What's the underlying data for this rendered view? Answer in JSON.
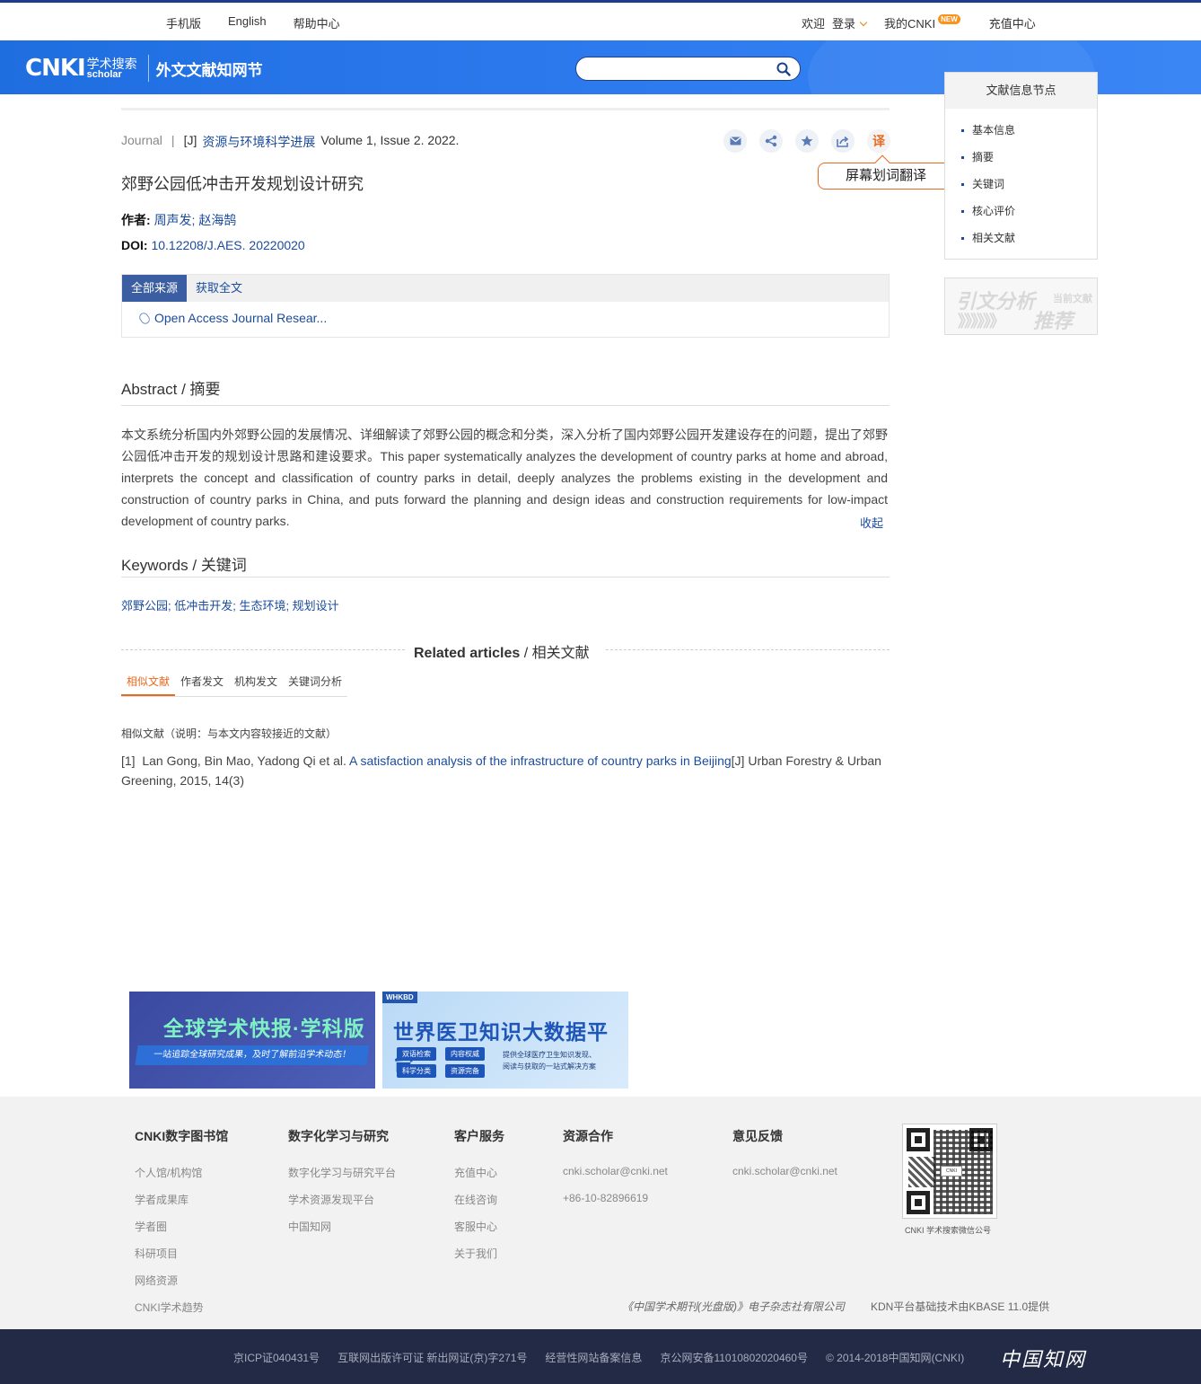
{
  "topbar": {
    "left_links": [
      "手机版",
      "English",
      "帮助中心"
    ],
    "welcome": "欢迎",
    "login": "登录",
    "my_cnki": "我的CNKI",
    "new_badge": "NEW",
    "recharge": "充值中心"
  },
  "header": {
    "logo_main": "CNKI",
    "logo_cn": "学术搜索",
    "logo_en": "scholar",
    "site_title": "外文文献知网节",
    "search_value": ""
  },
  "article": {
    "type": "Journal",
    "journal_code": "[J]",
    "journal": "资源与环境科学进展",
    "volume": "Volume 1, Issue 2. 2022.",
    "title": "郊野公园低冲击开发规划设计研究",
    "authors_label": "作者:",
    "authors": "周声发; 赵海鹄",
    "doi_label": "DOI:",
    "doi": "10.12208/J.AES. 20220020"
  },
  "tools": {
    "translate_glyph": "译",
    "tooltip": "屏幕划词翻译"
  },
  "source": {
    "tabs": [
      "全部来源",
      "获取全文"
    ],
    "link": "Open Access Journal Resear..."
  },
  "abstract": {
    "heading_en": "Abstract",
    "heading_cn": "摘要",
    "text": "本文系统分析国内外郊野公园的发展情况、详细解读了郊野公园的概念和分类，深入分析了国内郊野公园开发建设存在的问题，提出了郊野公园低冲击开发的规划设计思路和建设要求。This paper systematically analyzes the development of country parks at home and abroad, interprets the concept and classification of country parks in detail, deeply analyzes the problems existing in the development and construction of country parks in China, and puts forward the planning and design ideas and construction requirements for low-impact development of country parks.",
    "collapse": "收起"
  },
  "keywords": {
    "heading_en": "Keywords",
    "heading_cn": "关键词",
    "text": "郊野公园; 低冲击开发; 生态环境; 规划设计"
  },
  "related": {
    "heading_en": "Related articles",
    "heading_cn": "相关文献",
    "tabs": [
      "相似文献",
      "作者发文",
      "机构发文",
      "关键词分析"
    ],
    "note": "相似文献（说明：与本文内容较接近的文献）",
    "ref_index": "[1]",
    "ref_authors": "Lan Gong, Bin Mao, Yadong Qi et al.",
    "ref_title": "A satisfaction analysis of the infrastructure of country parks in Beijing",
    "ref_tail": "[J]  Urban Forestry & Urban Greening, 2015, 14(3)"
  },
  "sidebar": {
    "heading": "文献信息节点",
    "items": [
      "基本信息",
      "摘要",
      "关键词",
      "核心评价",
      "相关文献"
    ],
    "cite_a": "引文分析",
    "cite_b": "》》》》》》",
    "cite_c": "推荐",
    "cite_d": "当前文献"
  },
  "banners": {
    "b1_title": "全球学术快报·学科版",
    "b1_sub": "一站追踪全球研究成果，及时了解前沿学术动态！",
    "b2_tag": "WHKBD",
    "b2_title": "世界医卫知识大数据平台",
    "b2_pills": [
      "双语检索",
      "内容权威",
      "科学分类",
      "资源完备"
    ],
    "b2_desc1": "提供全球医疗卫生知识发现、",
    "b2_desc2": "阅读与获取的一站式解决方案"
  },
  "footer": {
    "cols": [
      {
        "title": "CNKI数字图书馆",
        "items": [
          "个人馆/机构馆",
          "学者成果库",
          "学者圈",
          "科研项目",
          "网络资源",
          "CNKI学术趋势"
        ]
      },
      {
        "title": "数字化学习与研究",
        "items": [
          "数字化学习与研究平台",
          "学术资源发现平台",
          "中国知网"
        ]
      },
      {
        "title": "客户服务",
        "items": [
          "充值中心",
          "在线咨询",
          "客服中心",
          "关于我们"
        ]
      },
      {
        "title": "资源合作",
        "items": [
          "cnki.scholar@cnki.net",
          "+86-10-82896619"
        ]
      },
      {
        "title": "意见反馈",
        "items": [
          "cnki.scholar@cnki.net"
        ]
      }
    ],
    "qr_caption": "CNKI 学术搜索微信公号",
    "publisher": "《中国学术期刊(光盘版)》电子杂志社有限公司",
    "tech": "KDN平台基础技术由KBASE 11.0提供"
  },
  "bottombar": {
    "items": [
      "京ICP证040431号",
      "互联网出版许可证 新出网证(京)字271号",
      "经营性网站备案信息",
      "京公网安备11010802020460号",
      "© 2014-2018中国知网(CNKI)"
    ],
    "brand": "中国知网"
  }
}
